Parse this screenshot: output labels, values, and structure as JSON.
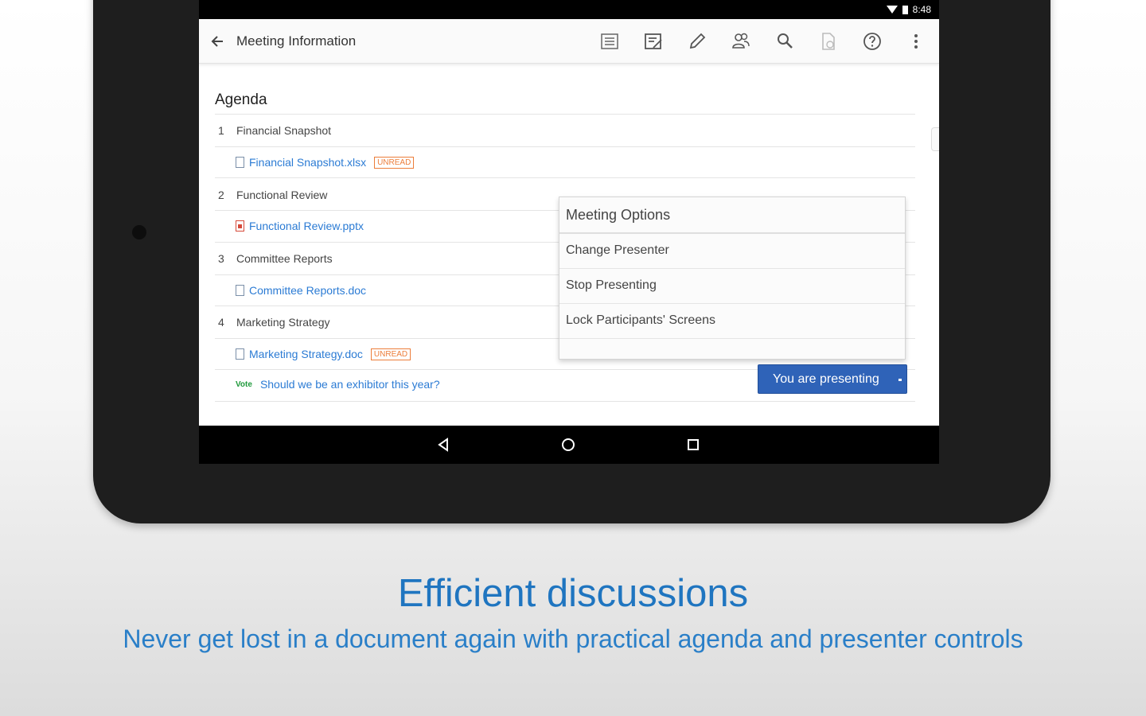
{
  "status_bar": {
    "time": "8:48"
  },
  "app_bar": {
    "title": "Meeting Information",
    "icons": [
      "back-arrow-icon",
      "agenda-icon",
      "notes-icon",
      "pencil-icon",
      "participants-icon",
      "search-icon",
      "document-icon",
      "help-icon",
      "overflow-menu-icon"
    ]
  },
  "agenda": {
    "title": "Agenda",
    "items": [
      {
        "number": "1",
        "label": "Financial Snapshot",
        "attachment": "Financial Snapshot.xlsx",
        "badge": "UNREAD"
      },
      {
        "number": "2",
        "label": "Functional Review",
        "attachment": "Functional Review.pptx",
        "badge": ""
      },
      {
        "number": "3",
        "label": "Committee Reports",
        "attachment": "Committee Reports.doc",
        "badge": ""
      },
      {
        "number": "4",
        "label": "Marketing Strategy",
        "attachment": "Marketing Strategy.doc",
        "badge": "UNREAD"
      }
    ],
    "vote": {
      "label": "Vote",
      "question": "Should we be an exhibitor this year?"
    }
  },
  "meeting_options_menu": {
    "header": "Meeting Options",
    "items": [
      "Change Presenter",
      "Stop Presenting",
      "Lock Participants' Screens"
    ]
  },
  "presenting_button": {
    "label": "You are presenting"
  },
  "nav_bar": {
    "icons": [
      "back-triangle-icon",
      "home-circle-icon",
      "recents-square-icon"
    ]
  },
  "caption": {
    "headline": "Efficient discussions",
    "subline": "Never get lost in a document again with practical agenda and presenter controls"
  },
  "colors": {
    "accent": "#1f75c0",
    "button": "#2f63b8",
    "link": "#2b7bd4",
    "unread": "#ec7d3a",
    "vote": "#1f9a3c"
  }
}
